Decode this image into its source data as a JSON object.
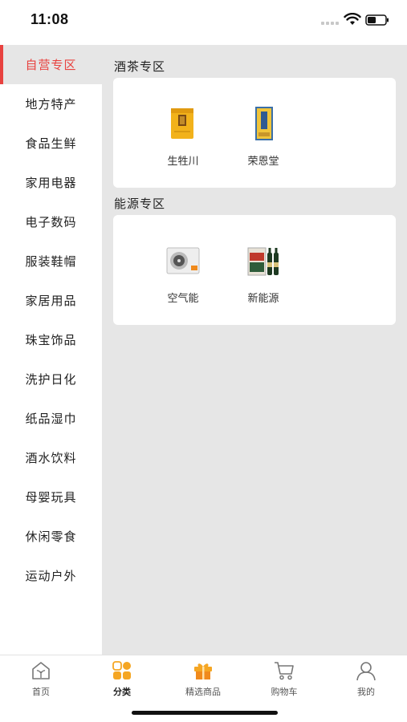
{
  "status_bar": {
    "time": "11:08"
  },
  "sidebar": {
    "items": [
      {
        "label": "自营专区",
        "active": true
      },
      {
        "label": "地方特产"
      },
      {
        "label": "食品生鲜"
      },
      {
        "label": "家用电器"
      },
      {
        "label": "电子数码"
      },
      {
        "label": "服装鞋帽"
      },
      {
        "label": "家居用品"
      },
      {
        "label": "珠宝饰品"
      },
      {
        "label": "洗护日化"
      },
      {
        "label": "纸品湿巾"
      },
      {
        "label": "酒水饮料"
      },
      {
        "label": "母婴玩具"
      },
      {
        "label": "休闲零食"
      },
      {
        "label": "运动户外"
      }
    ]
  },
  "sections": [
    {
      "title": "酒茶专区",
      "products": [
        {
          "name": "生牲川"
        },
        {
          "name": "荣恩堂"
        }
      ]
    },
    {
      "title": "能源专区",
      "products": [
        {
          "name": "空气能"
        },
        {
          "name": "新能源"
        }
      ]
    }
  ],
  "tabbar": {
    "tabs": [
      {
        "label": "首页",
        "icon": "home-icon"
      },
      {
        "label": "分类",
        "icon": "category-icon",
        "active": true
      },
      {
        "label": "精选商品",
        "icon": "gift-icon"
      },
      {
        "label": "购物车",
        "icon": "cart-icon"
      },
      {
        "label": "我的",
        "icon": "profile-icon"
      }
    ]
  },
  "colors": {
    "accent": "#e8423f",
    "orange": "#f5a623",
    "panel_bg": "#e6e6e6"
  }
}
